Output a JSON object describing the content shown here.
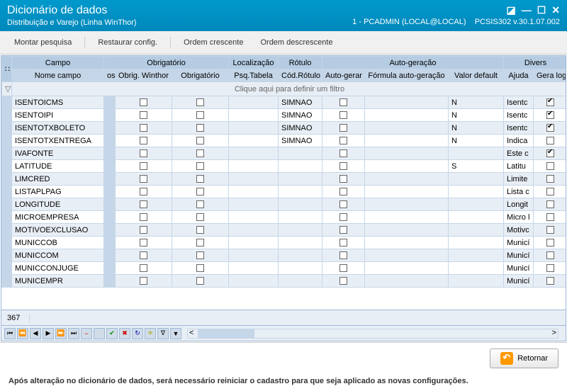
{
  "title": {
    "main": "Dicionário de dados",
    "sub": "Distribuição e Varejo (Linha WinThor)"
  },
  "status": {
    "conn": "1 - PCADMIN (LOCAL@LOCAL)",
    "ver": "PCSIS302   v.30.1.07.002"
  },
  "toolbar": {
    "montar": "Montar pesquisa",
    "restaurar": "Restaurar config.",
    "asc": "Ordem crescente",
    "desc": "Ordem descrescente"
  },
  "headers": {
    "campo": "Campo",
    "nome": "Nome campo",
    "os": "os",
    "obrig_grp": "Obrigatório",
    "obrig_w": "Obrig. Winthor",
    "obrig": "Obrigatório",
    "local": "Localização",
    "psq": "Psq.Tabela",
    "rotulo": "Rótulo",
    "cod": "Cód.Rótulo",
    "autogrp": "Auto-geração",
    "autogerar": "Auto-gerar",
    "formula": "Fórmula auto-geração",
    "default": "Valor default",
    "divers": "Divers",
    "ajuda": "Ajuda",
    "log": "Gera log"
  },
  "filter_text": "Clique aqui para definir um filtro",
  "record_count": "367",
  "return_label": "Retornar",
  "warning_text": "Após alteração no dicionário de dados, será necessário reiniciar o cadastro para que seja aplicado as novas configurações.",
  "rows": [
    {
      "nome": "ISENTOICMS",
      "cod": "SIMNAO",
      "def": "N",
      "ajuda": "Isentc",
      "log": true
    },
    {
      "nome": "ISENTOIPI",
      "cod": "SIMNAO",
      "def": "N",
      "ajuda": "Isentc",
      "log": true
    },
    {
      "nome": "ISENTOTXBOLETO",
      "cod": "SIMNAO",
      "def": "N",
      "ajuda": "Isentc",
      "log": true
    },
    {
      "nome": "ISENTOTXENTREGA",
      "cod": "SIMNAO",
      "def": "N",
      "ajuda": "Indica",
      "log": false
    },
    {
      "nome": "IVAFONTE",
      "cod": "",
      "def": "",
      "ajuda": "Este c",
      "log": true
    },
    {
      "nome": "LATITUDE",
      "cod": "",
      "def": "S",
      "ajuda": "Latitu",
      "log": false
    },
    {
      "nome": "LIMCRED",
      "cod": "",
      "def": "",
      "ajuda": "Limite",
      "log": false
    },
    {
      "nome": "LISTAPLPAG",
      "cod": "",
      "def": "",
      "ajuda": "Lista c",
      "log": false
    },
    {
      "nome": "LONGITUDE",
      "cod": "",
      "def": "",
      "ajuda": "Longit",
      "log": false
    },
    {
      "nome": "MICROEMPRESA",
      "cod": "",
      "def": "",
      "ajuda": "Micro l",
      "log": false
    },
    {
      "nome": "MOTIVOEXCLUSAO",
      "cod": "",
      "def": "",
      "ajuda": "Motivc",
      "log": false
    },
    {
      "nome": "MUNICCOB",
      "cod": "",
      "def": "",
      "ajuda": "Municí",
      "log": false
    },
    {
      "nome": "MUNICCOM",
      "cod": "",
      "def": "",
      "ajuda": "Municí",
      "log": false
    },
    {
      "nome": "MUNICCONJUGE",
      "cod": "",
      "def": "",
      "ajuda": "Municí",
      "log": false
    },
    {
      "nome": "MUNICEMPR",
      "cod": "",
      "def": "",
      "ajuda": "Municí",
      "log": false
    }
  ]
}
